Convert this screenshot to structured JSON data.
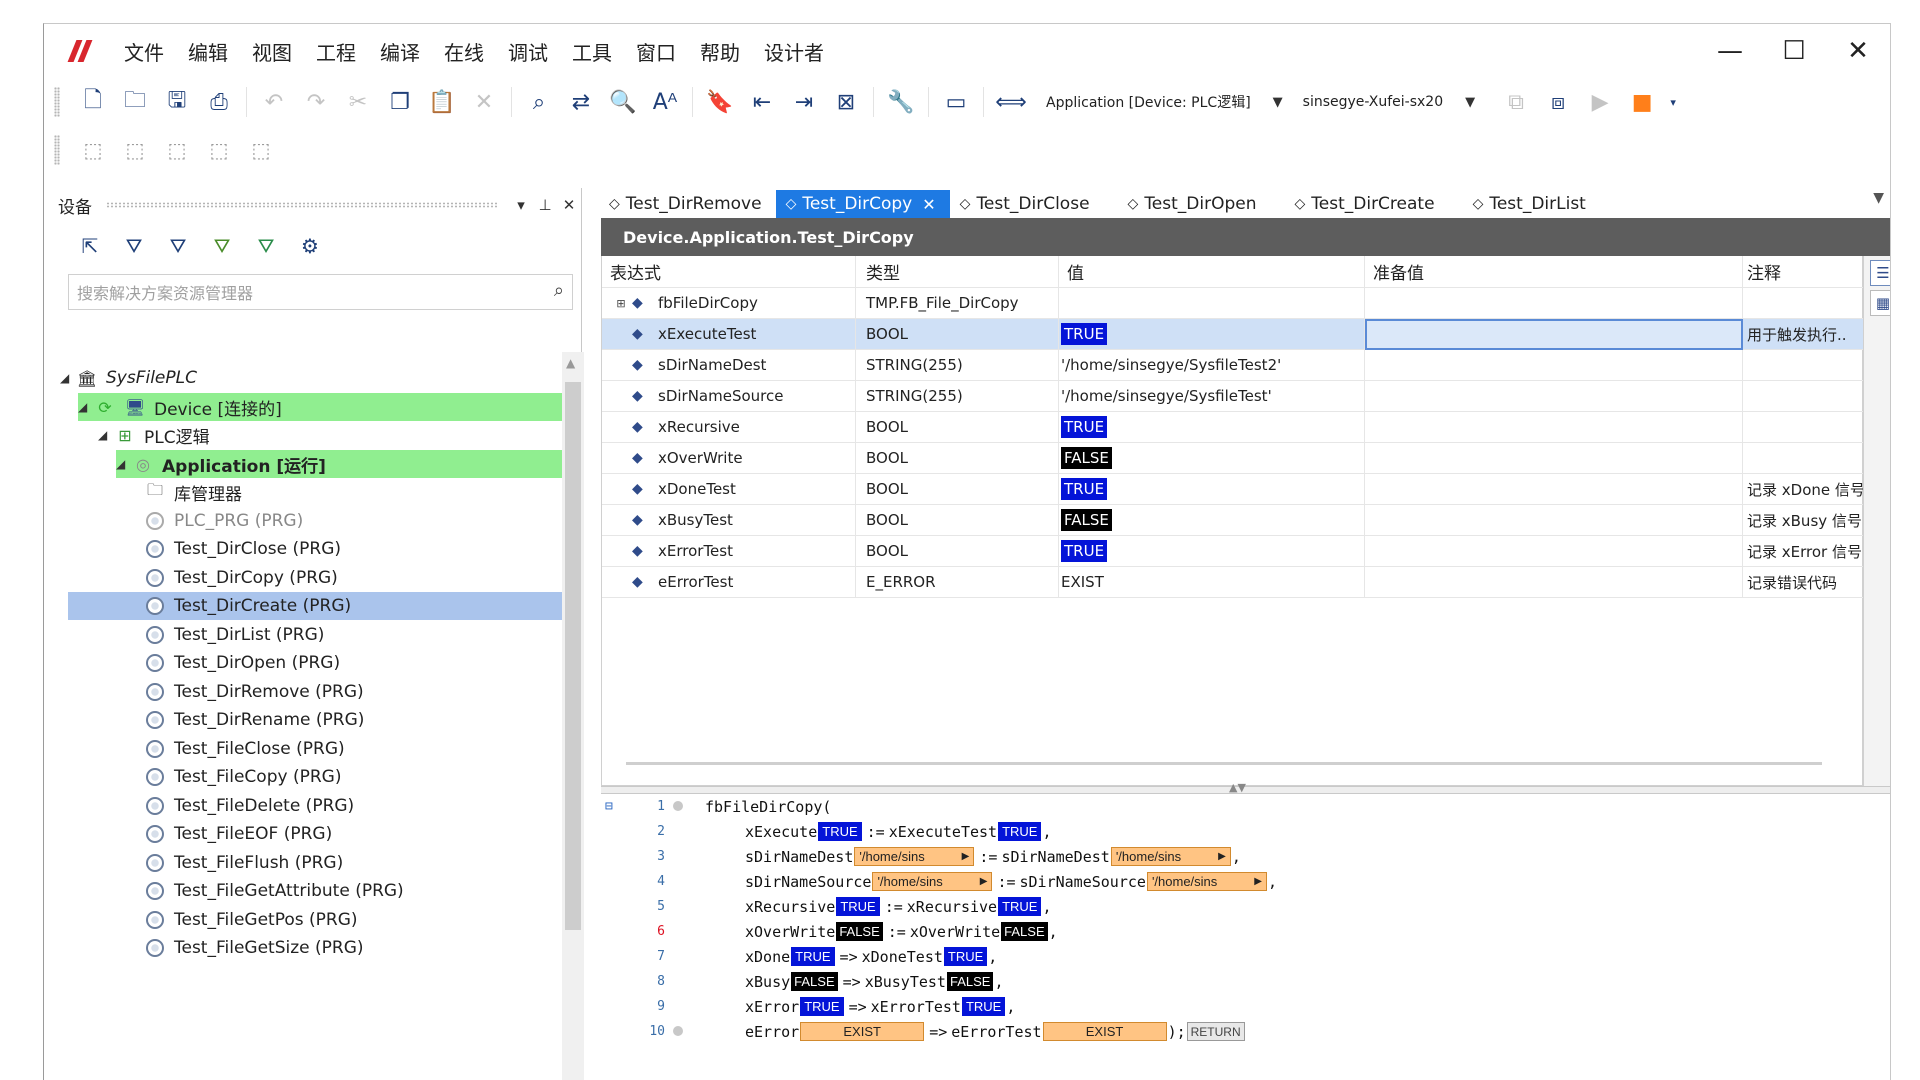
{
  "menu": [
    "文件",
    "编辑",
    "视图",
    "工程",
    "编译",
    "在线",
    "调试",
    "工具",
    "窗口",
    "帮助",
    "设计者"
  ],
  "toolbar": {
    "device_combo": "Application [Device: PLC逻辑]",
    "target_combo": "sinsegye-Xufei-sx20"
  },
  "device_pane": {
    "title": "设备",
    "search_placeholder": "搜索解决方案资源管理器",
    "tree": [
      {
        "label": "SysFilePLC"
      },
      {
        "label": "Device [连接的]"
      },
      {
        "label": "PLC逻辑"
      },
      {
        "label": "Application [运行]"
      },
      {
        "label": "库管理器"
      },
      {
        "label": "PLC_PRG (PRG)"
      },
      {
        "label": "Test_DirClose (PRG)"
      },
      {
        "label": "Test_DirCopy (PRG)"
      },
      {
        "label": "Test_DirCreate (PRG)"
      },
      {
        "label": "Test_DirList (PRG)"
      },
      {
        "label": "Test_DirOpen (PRG)"
      },
      {
        "label": "Test_DirRemove (PRG)"
      },
      {
        "label": "Test_DirRename (PRG)"
      },
      {
        "label": "Test_FileClose (PRG)"
      },
      {
        "label": "Test_FileCopy (PRG)"
      },
      {
        "label": "Test_FileDelete (PRG)"
      },
      {
        "label": "Test_FileEOF (PRG)"
      },
      {
        "label": "Test_FileFlush (PRG)"
      },
      {
        "label": "Test_FileGetAttribute (PRG)"
      },
      {
        "label": "Test_FileGetPos (PRG)"
      },
      {
        "label": "Test_FileGetSize (PRG)"
      }
    ]
  },
  "tabs": [
    "Test_DirRemove",
    "Test_DirCopy",
    "Test_DirClose",
    "Test_DirOpen",
    "Test_DirCreate",
    "Test_DirList"
  ],
  "editor": {
    "title": "Device.Application.Test_DirCopy",
    "columns": {
      "expr": "表达式",
      "type": "类型",
      "value": "值",
      "prepared": "准备值",
      "comment": "注释"
    },
    "rows": [
      {
        "expr": "fbFileDirCopy",
        "type": "TMP.FB_File_DirCopy",
        "value": "",
        "comment": ""
      },
      {
        "expr": "xExecuteTest",
        "type": "BOOL",
        "value": "TRUE",
        "comment": "用于触发执行.."
      },
      {
        "expr": "sDirNameDest",
        "type": "STRING(255)",
        "value": "'/home/sinsegye/SysfileTest2'",
        "comment": ""
      },
      {
        "expr": "sDirNameSource",
        "type": "STRING(255)",
        "value": "'/home/sinsegye/SysfileTest'",
        "comment": ""
      },
      {
        "expr": "xRecursive",
        "type": "BOOL",
        "value": "TRUE",
        "comment": ""
      },
      {
        "expr": "xOverWrite",
        "type": "BOOL",
        "value": "FALSE",
        "comment": ""
      },
      {
        "expr": "xDoneTest",
        "type": "BOOL",
        "value": "TRUE",
        "comment": "记录 xDone 信号"
      },
      {
        "expr": "xBusyTest",
        "type": "BOOL",
        "value": "FALSE",
        "comment": "记录 xBusy 信号"
      },
      {
        "expr": "xErrorTest",
        "type": "BOOL",
        "value": "TRUE",
        "comment": "记录 xError 信号"
      },
      {
        "expr": "eErrorTest",
        "type": "E_ERROR",
        "value": "EXIST",
        "comment": "记录错误代码"
      }
    ]
  },
  "code": {
    "line_numbers": [
      "1",
      "2",
      "3",
      "4",
      "5",
      "6",
      "7",
      "8",
      "9",
      "10"
    ],
    "call": "fbFileDirCopy(",
    "str_short": "'/home/sins",
    "true_label": "TRUE",
    "false_label": "FALSE",
    "exist_label": "EXIST",
    "return_label": "RETURN",
    "lines": [
      {
        "param": "xExecute",
        "op": ":=",
        "var": "xExecuteTest",
        "end": ","
      },
      {
        "param": "sDirNameDest",
        "op": ":=",
        "var": "sDirNameDest",
        "end": ","
      },
      {
        "param": "sDirNameSource",
        "op": ":=",
        "var": "sDirNameSource",
        "end": ","
      },
      {
        "param": "xRecursive",
        "op": ":=",
        "var": "xRecursive",
        "end": ","
      },
      {
        "param": "xOverWrite",
        "op": ":=",
        "var": "xOverWrite",
        "end": ","
      },
      {
        "param": "xDone",
        "op": "=>",
        "var": "xDoneTest",
        "end": ","
      },
      {
        "param": "xBusy",
        "op": "=>",
        "var": "xBusyTest",
        "end": ","
      },
      {
        "param": "xError",
        "op": "=>",
        "var": "xErrorTest",
        "end": ","
      },
      {
        "param": "eError",
        "op": "=>",
        "var": "eErrorTest",
        "end": ");"
      }
    ]
  },
  "colors": {
    "accent_tab": "#1e7ae3",
    "true_badge": "#0414d8",
    "false_badge": "#000000",
    "connected_highlight": "#90ee90",
    "selected_highlight": "#aac4ec",
    "string_value": "#ffc483"
  }
}
